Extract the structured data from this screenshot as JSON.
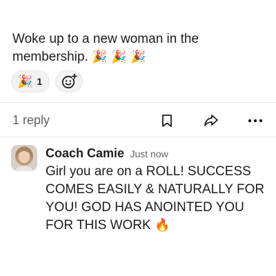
{
  "post": {
    "text": "Woke up to a new woman in the membership.",
    "emojis": "🎉 🎉 🎉"
  },
  "reactions": [
    {
      "emoji": "🎉",
      "count": "1"
    }
  ],
  "actions": {
    "reply_count": "1 reply",
    "icons": [
      "bookmark-icon",
      "share-icon",
      "more-icon"
    ]
  },
  "reply": {
    "author": "Coach Camie",
    "time": "Just now",
    "text": "Girl you are on a ROLL! SUCCESS COMES EASILY & NATURALLY FOR YOU! GOD HAS ANOINTED YOU FOR THIS WORK",
    "emoji": "🔥"
  },
  "colors": {
    "text": "#1d1c1d",
    "muted": "#616061",
    "pill_bg": "#f2f2f2",
    "divider": "#e5e5e5"
  }
}
